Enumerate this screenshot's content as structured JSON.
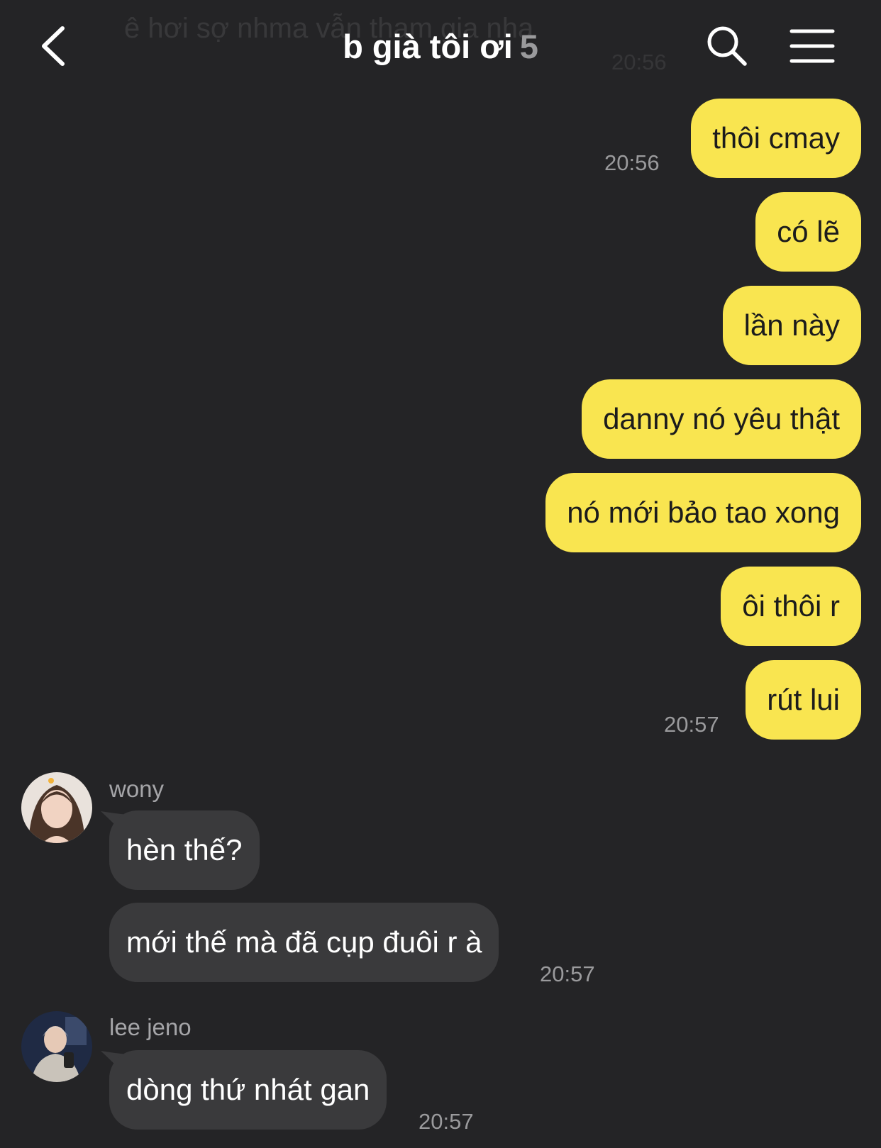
{
  "header": {
    "title": "b già tôi ơi",
    "member_count": "5",
    "back_icon": "chevron-left-icon",
    "search_icon": "search-icon",
    "menu_icon": "hamburger-menu-icon",
    "prev_message_preview": "ê hơi sợ nhma vẫn tham gia nha",
    "prev_message_time": "20:56"
  },
  "colors": {
    "background": "#242426",
    "outgoing_bubble": "#f9e550",
    "incoming_bubble": "#3a3a3c",
    "timestamp": "#9a9a9c"
  },
  "outgoing": [
    {
      "text": "thôi cmay",
      "time": "20:56"
    },
    {
      "text": "có lẽ"
    },
    {
      "text": "lần này"
    },
    {
      "text": "danny nó yêu thật"
    },
    {
      "text": "nó mới bảo tao xong"
    },
    {
      "text": "ôi thôi r"
    },
    {
      "text": "rút lui",
      "time": "20:57"
    }
  ],
  "incoming": [
    {
      "sender": "wony",
      "messages": [
        {
          "text": "hèn thế?"
        },
        {
          "text": "mới thế mà đã cụp đuôi r à",
          "time": "20:57"
        }
      ]
    },
    {
      "sender": "lee jeno",
      "messages": [
        {
          "text": "dòng thứ nhát gan",
          "time": "20:57"
        }
      ]
    }
  ]
}
